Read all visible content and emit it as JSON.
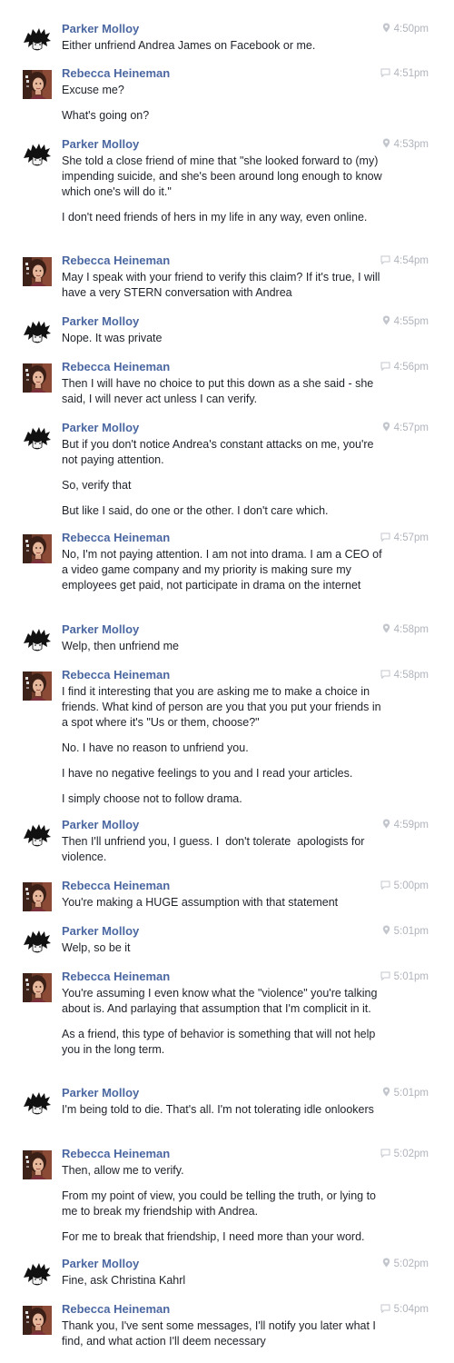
{
  "colors": {
    "sender_name": "#4b67a1",
    "message_text": "#1d2129",
    "meta_text": "#b0b4bc",
    "background": "#ffffff"
  },
  "participants": {
    "parker": {
      "name": "Parker Molloy",
      "avatar_icon": "parker-avatar-icon",
      "meta_icon": "location-pin-icon"
    },
    "rebecca": {
      "name": "Rebecca Heineman",
      "avatar_icon": "rebecca-avatar-icon",
      "meta_icon": "chat-bubble-icon"
    }
  },
  "messages": [
    {
      "sender": "Parker Molloy",
      "time": "4:50pm",
      "lines": [
        "Either unfriend Andrea James on Facebook or me."
      ]
    },
    {
      "sender": "Rebecca Heineman",
      "time": "4:51pm",
      "lines": [
        "Excuse me?",
        "What's going on?"
      ]
    },
    {
      "sender": "Parker Molloy",
      "time": "4:53pm",
      "lines": [
        "She told a close friend of mine that \"she looked forward to (my) impending suicide, and she's been around long enough to know which one's will do it.\"",
        "I don't need friends of hers in my life in any way, even online."
      ]
    },
    {
      "sender": "Rebecca Heineman",
      "time": "4:54pm",
      "lines": [
        "May I speak with your friend to verify this claim? If it's true, I will have a very STERN conversation with Andrea"
      ]
    },
    {
      "sender": "Parker Molloy",
      "time": "4:55pm",
      "lines": [
        "Nope. It was private"
      ]
    },
    {
      "sender": "Rebecca Heineman",
      "time": "4:56pm",
      "lines": [
        "Then I will have no choice to put this down as a she said - she said, I will never act unless I can verify."
      ]
    },
    {
      "sender": "Parker Molloy",
      "time": "4:57pm",
      "lines": [
        "But if you don't notice Andrea's constant attacks on me, you're not paying attention.",
        "So, verify that",
        "But like I said, do one or the other. I don't care which."
      ]
    },
    {
      "sender": "Rebecca Heineman",
      "time": "4:57pm",
      "lines": [
        "No, I'm not paying attention. I am not into drama. I am a CEO of a video game company and my priority is making sure my employees get paid, not participate in drama on the internet"
      ]
    },
    {
      "sender": "Parker Molloy",
      "time": "4:58pm",
      "lines": [
        "Welp, then unfriend me"
      ]
    },
    {
      "sender": "Rebecca Heineman",
      "time": "4:58pm",
      "lines": [
        "I find it interesting that you are asking me to make a choice in friends. What kind of person are you that you put your friends in a spot where it's \"Us or them, choose?\"",
        "No. I have no reason to unfriend you.",
        "I have no negative feelings to you and I read your articles.",
        "I simply choose not to follow drama."
      ]
    },
    {
      "sender": "Parker Molloy",
      "time": "4:59pm",
      "lines": [
        "Then I'll unfriend you, I guess. I  don't tolerate  apologists for violence."
      ]
    },
    {
      "sender": "Rebecca Heineman",
      "time": "5:00pm",
      "lines": [
        "You're making a HUGE assumption with that statement"
      ]
    },
    {
      "sender": "Parker Molloy",
      "time": "5:01pm",
      "lines": [
        "Welp, so be it"
      ]
    },
    {
      "sender": "Rebecca Heineman",
      "time": "5:01pm",
      "lines": [
        "You're assuming I even know what the \"violence\" you're talking about is. And parlaying that assumption that I'm complicit in it.",
        "As a friend, this type of behavior is something that will not help you in the long term."
      ]
    },
    {
      "sender": "Parker Molloy",
      "time": "5:01pm",
      "lines": [
        "I'm being told to die. That's all. I'm not tolerating idle onlookers"
      ]
    },
    {
      "sender": "Rebecca Heineman",
      "time": "5:02pm",
      "lines": [
        "Then, allow me to verify.",
        "From my point of view, you could be telling the truth, or lying to me to break my friendship with Andrea.",
        "For me to break that friendship, I need more than your word."
      ]
    },
    {
      "sender": "Parker Molloy",
      "time": "5:02pm",
      "lines": [
        "Fine, ask Christina Kahrl"
      ]
    },
    {
      "sender": "Rebecca Heineman",
      "time": "5:04pm",
      "lines": [
        "Thank you, I've sent some messages, I'll notify you later what I find, and what action I'll deem necessary"
      ]
    }
  ]
}
